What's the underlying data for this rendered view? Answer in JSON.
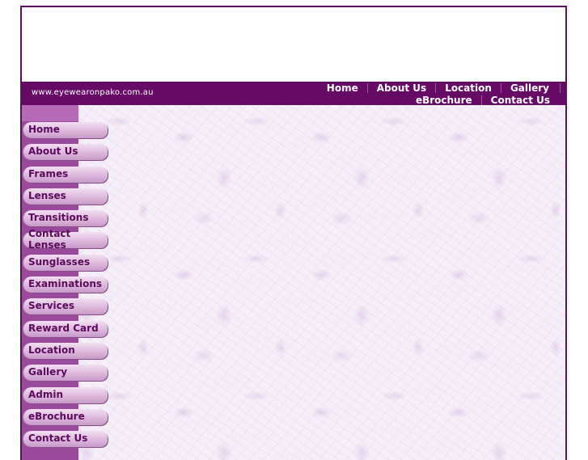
{
  "site": {
    "url": "www.eyewearonpako.com.au"
  },
  "top_nav": {
    "row1": [
      "Home",
      "About Us",
      "Location",
      "Gallery"
    ],
    "row2": [
      "eBrochure",
      "Contact Us"
    ]
  },
  "side_menu": [
    {
      "label": "Home"
    },
    {
      "label": "About Us"
    },
    {
      "label": "Frames"
    },
    {
      "label": "Lenses"
    },
    {
      "label": "Transitions"
    },
    {
      "label": "Contact Lenses"
    },
    {
      "label": "Sunglasses"
    },
    {
      "label": "Examinations"
    },
    {
      "label": "Services"
    },
    {
      "label": "Reward Card"
    },
    {
      "label": "Location"
    },
    {
      "label": "Gallery"
    },
    {
      "label": "Admin"
    },
    {
      "label": "eBrochure"
    },
    {
      "label": "Contact Us"
    }
  ],
  "colors": {
    "border": "#5e0e5e",
    "header_bar": "#660a66",
    "left_column": "#9a4a9a",
    "menu_text": "#5a0a5a",
    "content_bg": "#f6eef8"
  }
}
